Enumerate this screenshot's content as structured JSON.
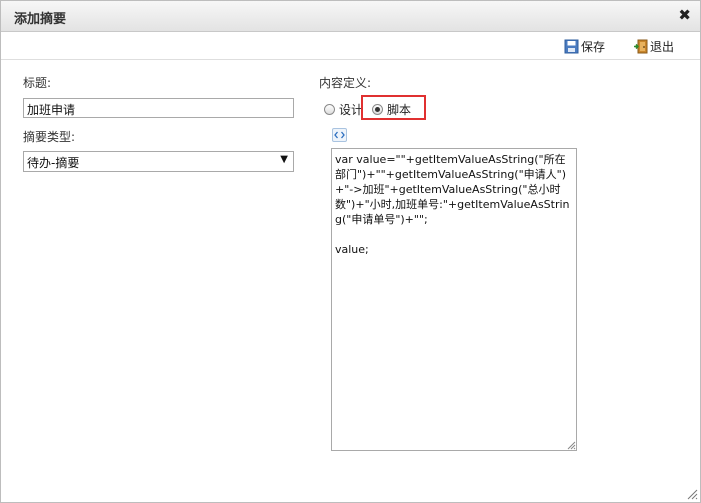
{
  "dialog": {
    "title": "添加摘要",
    "close_symbol": "✖"
  },
  "toolbar": {
    "save_label": "保存",
    "exit_label": "退出",
    "save_icon": "save-disk-icon",
    "exit_icon": "exit-door-icon"
  },
  "form": {
    "title_label": "标题:",
    "title_value": "加班申请",
    "type_label": "摘要类型:",
    "type_selected": "待办-摘要",
    "content_label": "内容定义:",
    "radio_design_label": "设计",
    "radio_script_label": "脚本",
    "selected_mode": "脚本",
    "script_text": "var value=\"\"+getItemValueAsString(\"所在部门\")+\"\"+getItemValueAsString(\"申请人\")+\"->加班\"+getItemValueAsString(\"总小时数\")+\"小时,加班单号:\"+getItemValueAsString(\"申请单号\")+\"\";\n\nvalue;"
  },
  "colors": {
    "highlight": "#e03030",
    "titlebar": "#e3e3e3"
  }
}
